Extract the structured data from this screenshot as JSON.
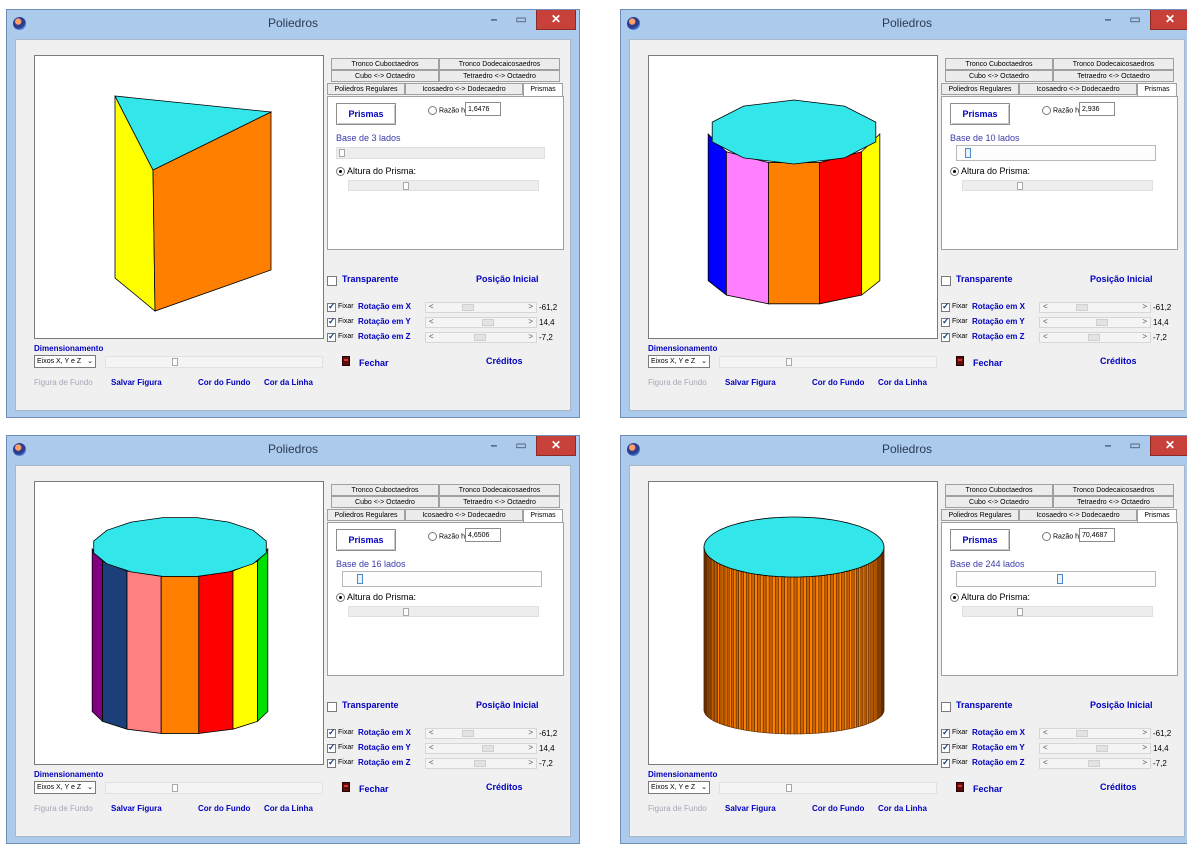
{
  "windows": [
    {
      "title": "Poliedros",
      "tabs": {
        "row1": [
          "Tronco Cuboctaedros",
          "Tronco Dodecaicosaedros"
        ],
        "row2": [
          "Cubo <-> Octaedro",
          "Tetraedro <-> Octaedro"
        ],
        "row3": [
          "Poliedros Regulares",
          "Icosaedro <-> Dodecaedro",
          "Prismas"
        ]
      },
      "prismas_button": "Prismas",
      "razao_label": "Razão h/L:",
      "razao_value": "1,6476",
      "base_label": "Base de 3 lados",
      "base_slider": 0.0,
      "altura_label": "Altura do Prisma:",
      "altura_slider": 0.3,
      "transparente_label": "Transparente",
      "posicao_inicial": "Posição Inicial",
      "rotations": [
        {
          "fixar": "Fixar",
          "label": "Rotação em X",
          "value": "-61,2"
        },
        {
          "fixar": "Fixar",
          "label": "Rotação em Y",
          "value": "14,4"
        },
        {
          "fixar": "Fixar",
          "label": "Rotação em Z",
          "value": "-7,2"
        }
      ],
      "dimensionamento": "Dimensionamento",
      "eixos": "Eixos X, Y e Z",
      "fechar": "Fechar",
      "creditos": "Créditos",
      "figura_de_fundo": "Figura de Fundo",
      "salvar_figura": "Salvar Figura",
      "cor_do_fundo": "Cor do Fundo",
      "cor_da_linha": "Cor da Linha",
      "sides": 3,
      "top_color": "#33e6ea",
      "face_colors": [
        "#ffff00",
        "#ff8000"
      ]
    },
    {
      "title": "Poliedros",
      "tabs": {
        "row1": [
          "Tronco Cuboctaedros",
          "Tronco Dodecaicosaedros"
        ],
        "row2": [
          "Cubo <-> Octaedro",
          "Tetraedro <-> Octaedro"
        ],
        "row3": [
          "Poliedros Regulares",
          "Icosaedro <-> Dodecaedro",
          "Prismas"
        ]
      },
      "prismas_button": "Prismas",
      "razao_label": "Razão h/L:",
      "razao_value": "2,936",
      "base_label": "Base de 10 lados",
      "base_slider": 0.03,
      "altura_label": "Altura do Prisma:",
      "altura_slider": 0.3,
      "transparente_label": "Transparente",
      "posicao_inicial": "Posição Inicial",
      "rotations": [
        {
          "fixar": "Fixar",
          "label": "Rotação em X",
          "value": "-61,2"
        },
        {
          "fixar": "Fixar",
          "label": "Rotação em Y",
          "value": "14,4"
        },
        {
          "fixar": "Fixar",
          "label": "Rotação em Z",
          "value": "-7,2"
        }
      ],
      "dimensionamento": "Dimensionamento",
      "eixos": "Eixos X, Y e Z",
      "fechar": "Fechar",
      "creditos": "Créditos",
      "figura_de_fundo": "Figura de Fundo",
      "salvar_figura": "Salvar Figura",
      "cor_do_fundo": "Cor do Fundo",
      "cor_da_linha": "Cor da Linha",
      "sides": 10,
      "top_color": "#33e6ea",
      "face_colors": [
        "#0000ff",
        "#ff80ff",
        "#ff8000",
        "#ff0000",
        "#ffff00"
      ]
    },
    {
      "title": "Poliedros",
      "tabs": {
        "row1": [
          "Tronco Cuboctaedros",
          "Tronco Dodecaicosaedros"
        ],
        "row2": [
          "Cubo <-> Octaedro",
          "Tetraedro <-> Octaedro"
        ],
        "row3": [
          "Poliedros Regulares",
          "Icosaedro <-> Dodecaedro",
          "Prismas"
        ]
      },
      "prismas_button": "Prismas",
      "razao_label": "Razão h/L:",
      "razao_value": "4,6506",
      "base_label": "Base de 16 lados",
      "base_slider": 0.06,
      "altura_label": "Altura do Prisma:",
      "altura_slider": 0.3,
      "transparente_label": "Transparente",
      "posicao_inicial": "Posição Inicial",
      "rotations": [
        {
          "fixar": "Fixar",
          "label": "Rotação em X",
          "value": "-61,2"
        },
        {
          "fixar": "Fixar",
          "label": "Rotação em Y",
          "value": "14,4"
        },
        {
          "fixar": "Fixar",
          "label": "Rotação em Z",
          "value": "-7,2"
        }
      ],
      "dimensionamento": "Dimensionamento",
      "eixos": "Eixos X, Y e Z",
      "fechar": "Fechar",
      "creditos": "Créditos",
      "figura_de_fundo": "Figura de Fundo",
      "salvar_figura": "Salvar Figura",
      "cor_do_fundo": "Cor do Fundo",
      "cor_da_linha": "Cor da Linha",
      "sides": 16,
      "top_color": "#33e6ea",
      "face_colors": [
        "#800080",
        "#1c3f7a",
        "#ff8080",
        "#ff8000",
        "#ff0000",
        "#ffff00",
        "#00e000"
      ]
    },
    {
      "title": "Poliedros",
      "tabs": {
        "row1": [
          "Tronco Cuboctaedros",
          "Tronco Dodecaicosaedros"
        ],
        "row2": [
          "Cubo <-> Octaedro",
          "Tetraedro <-> Octaedro"
        ],
        "row3": [
          "Poliedros Regulares",
          "Icosaedro <-> Dodecaedro",
          "Prismas"
        ]
      },
      "prismas_button": "Prismas",
      "razao_label": "Razão h/L:",
      "razao_value": "70,4687",
      "base_label": "Base de 244 lados",
      "base_slider": 0.5,
      "altura_label": "Altura do Prisma:",
      "altura_slider": 0.3,
      "transparente_label": "Transparente",
      "posicao_inicial": "Posição Inicial",
      "rotations": [
        {
          "fixar": "Fixar",
          "label": "Rotação em X",
          "value": "-61,2"
        },
        {
          "fixar": "Fixar",
          "label": "Rotação em Y",
          "value": "14,4"
        },
        {
          "fixar": "Fixar",
          "label": "Rotação em Z",
          "value": "-7,2"
        }
      ],
      "dimensionamento": "Dimensionamento",
      "eixos": "Eixos X, Y e Z",
      "fechar": "Fechar",
      "creditos": "Créditos",
      "figura_de_fundo": "Figura de Fundo",
      "salvar_figura": "Salvar Figura",
      "cor_do_fundo": "Cor do Fundo",
      "cor_da_linha": "Cor da Linha",
      "sides": 244,
      "top_color": "#33e6ea",
      "face_colors": [
        "#ff8000",
        "#5a2a00"
      ]
    }
  ]
}
